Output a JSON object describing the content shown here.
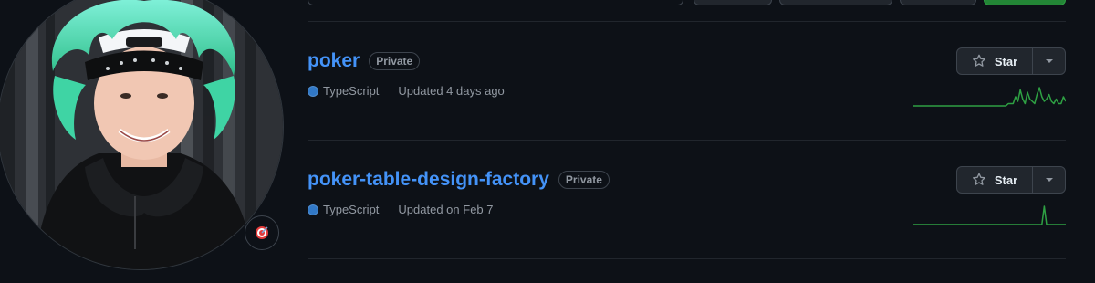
{
  "profile": {
    "avatar_alt": "profile-photo",
    "status_emoji": "🎯"
  },
  "repos": [
    {
      "name": "poker",
      "visibility": "Private",
      "language": "TypeScript",
      "language_color": "#3178c6",
      "updated": "Updated 4 days ago",
      "star_label": "Star",
      "activity": [
        0,
        0,
        0,
        0,
        0,
        0,
        0,
        0,
        0,
        0,
        0,
        0,
        0,
        0,
        0,
        0,
        0,
        0,
        0,
        0,
        0,
        0,
        0,
        0,
        0,
        0,
        0,
        0,
        0,
        0,
        0,
        0,
        0,
        0,
        0,
        0,
        0,
        0,
        0,
        0,
        1,
        1,
        1,
        4,
        2,
        7,
        3,
        1,
        6,
        3,
        2,
        1,
        5,
        8,
        4,
        2,
        3,
        5,
        2,
        1,
        3,
        1,
        1,
        4,
        2
      ]
    },
    {
      "name": "poker-table-design-factory",
      "visibility": "Private",
      "language": "TypeScript",
      "language_color": "#3178c6",
      "updated": "Updated on Feb 7",
      "star_label": "Star",
      "activity": [
        0,
        0,
        0,
        0,
        0,
        0,
        0,
        0,
        0,
        0,
        0,
        0,
        0,
        0,
        0,
        0,
        0,
        0,
        0,
        0,
        0,
        0,
        0,
        0,
        0,
        0,
        0,
        0,
        0,
        0,
        0,
        0,
        0,
        0,
        0,
        0,
        0,
        0,
        0,
        0,
        0,
        0,
        0,
        0,
        0,
        0,
        0,
        0,
        0,
        0,
        0,
        0,
        0,
        0,
        0,
        8,
        0,
        0,
        0,
        0,
        0,
        0,
        0,
        0,
        0
      ]
    }
  ],
  "colors": {
    "link": "#4493f8",
    "spark": "#2ea043"
  }
}
